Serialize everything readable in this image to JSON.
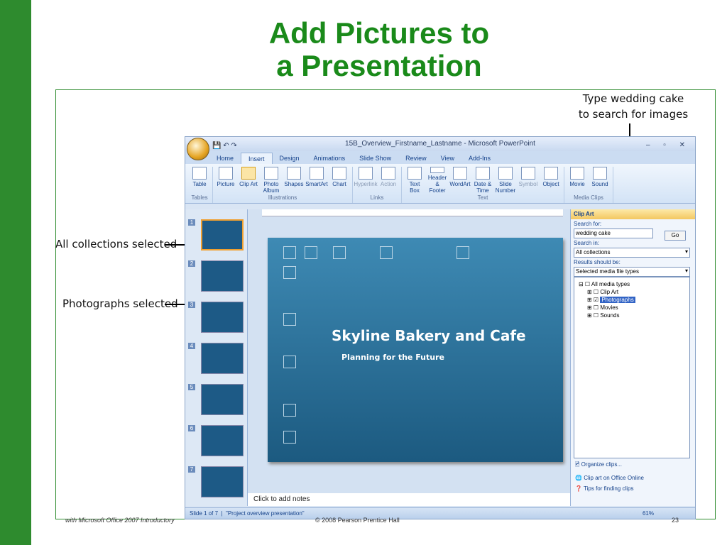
{
  "title": {
    "line1": "Add Pictures to",
    "line2": "a Presentation"
  },
  "callouts": {
    "wedding": {
      "line1": "Type wedding cake",
      "line2": "to search for images"
    },
    "collections": "All collections selected",
    "photographs": "Photographs selected"
  },
  "window": {
    "title": "15B_Overview_Firstname_Lastname - Microsoft PowerPoint"
  },
  "tabs": [
    "Home",
    "Insert",
    "Design",
    "Animations",
    "Slide Show",
    "Review",
    "View",
    "Add-Ins"
  ],
  "ribbon": [
    {
      "group": "Tables",
      "items": [
        "Table"
      ]
    },
    {
      "group": "Illustrations",
      "items": [
        "Picture",
        "Clip Art",
        "Photo Album",
        "Shapes",
        "SmartArt",
        "Chart"
      ]
    },
    {
      "group": "Links",
      "items": [
        "Hyperlink",
        "Action"
      ]
    },
    {
      "group": "Text",
      "items": [
        "Text Box",
        "Header & Footer",
        "WordArt",
        "Date & Time",
        "Slide Number",
        "Symbol",
        "Object"
      ]
    },
    {
      "group": "Media Clips",
      "items": [
        "Movie",
        "Sound"
      ]
    }
  ],
  "slide": {
    "title": "Skyline Bakery and Cafe",
    "subtitle": "Planning for the Future"
  },
  "notes": "Click to add notes",
  "clipart": {
    "title": "Clip Art",
    "search_label": "Search for:",
    "search_value": "wedding cake",
    "go": "Go",
    "search_in_label": "Search in:",
    "search_in_value": "All collections",
    "results_label": "Results should be:",
    "results_value": "Selected media file types",
    "tree": [
      "All media types",
      "Clip Art",
      "Photographs",
      "Movies",
      "Sounds"
    ],
    "links": [
      "Organize clips...",
      "Clip art on Office Online",
      "Tips for finding clips"
    ]
  },
  "status": {
    "slide": "Slide 1 of 7",
    "theme": "\"Project overview presentation\"",
    "zoom": "61%"
  },
  "footer": {
    "book": "with Microsoft Office 2007 Introductory",
    "copyright": "© 2008 Pearson Prentice Hall",
    "page": "23"
  }
}
